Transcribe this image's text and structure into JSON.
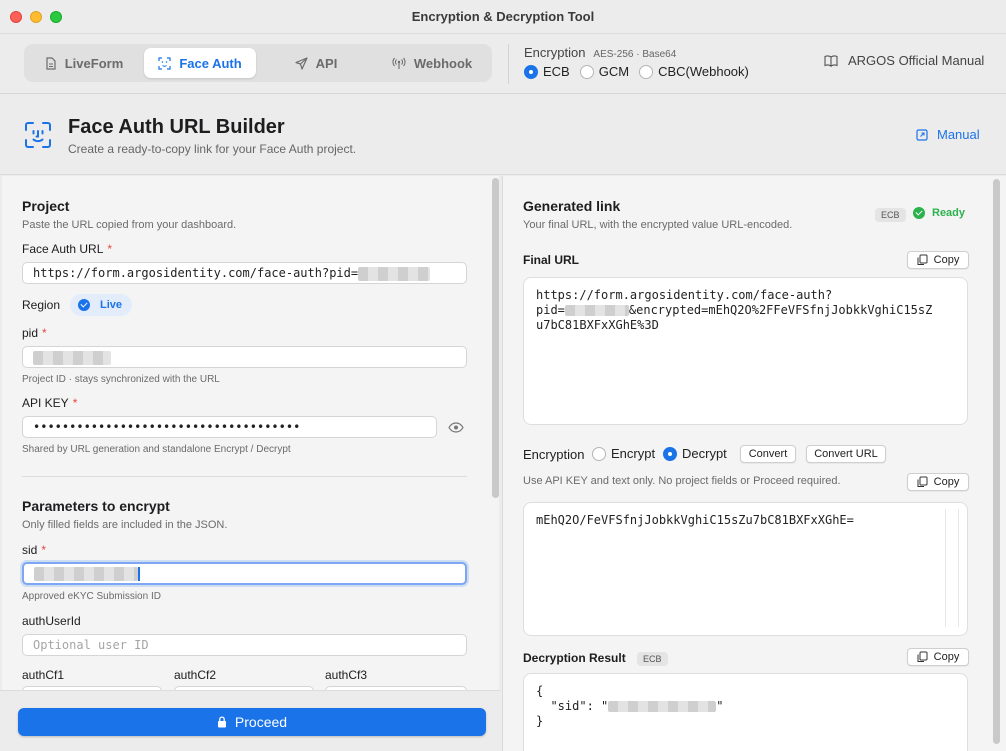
{
  "window": {
    "title": "Encryption & Decryption Tool"
  },
  "tabs": [
    {
      "label": "LiveForm",
      "icon": "document-icon"
    },
    {
      "label": "Face Auth",
      "icon": "face-id-icon",
      "active": true
    },
    {
      "label": "API",
      "icon": "paper-plane-icon"
    },
    {
      "label": "Webhook",
      "icon": "broadcast-icon"
    }
  ],
  "encryption_mode": {
    "label": "Encryption",
    "detail": "AES-256 · Base64",
    "options": [
      "ECB",
      "GCM",
      "CBC(Webhook)"
    ],
    "selected": "ECB"
  },
  "official_manual": {
    "label": "ARGOS Official Manual",
    "icon": "book-icon"
  },
  "header": {
    "title": "Face Auth URL Builder",
    "subtitle": "Create a ready-to-copy link for your Face Auth project.",
    "manual_label": "Manual"
  },
  "project": {
    "title": "Project",
    "hint": "Paste the URL copied from your dashboard.",
    "face_auth_url_label": "Face Auth URL",
    "face_auth_url_value": "https://form.argosidentity.com/face-auth?pid=",
    "region_label": "Region",
    "region_value": "Live",
    "pid_label": "pid",
    "pid_hint": "Project ID · stays synchronized with the URL",
    "api_key_label": "API KEY",
    "api_key_value": "•••••••••••••••••••••••••••••••••••••",
    "api_key_hint": "Shared by URL generation and standalone Encrypt / Decrypt"
  },
  "params": {
    "title": "Parameters to encrypt",
    "hint": "Only filled fields are included in the JSON.",
    "sid_label": "sid",
    "sid_hint": "Approved eKYC Submission ID",
    "auth_user_id_label": "authUserId",
    "auth_user_id_placeholder": "Optional user ID",
    "cf_labels": [
      "authCf1",
      "authCf2",
      "authCf3"
    ]
  },
  "proceed_label": "Proceed",
  "generated": {
    "title": "Generated link",
    "hint": "Your final URL, with the encrypted value URL-encoded.",
    "mode_chip": "ECB",
    "status": "Ready",
    "final_url_label": "Final URL",
    "copy_label": "Copy",
    "final_url_line1": "https://form.argosidentity.com/face-auth?",
    "final_url_line2_prefix": "pid=",
    "final_url_line2_suffix": "&encrypted=mEhQ2O%2FFeVFSfnjJobkkVghiC15sZ",
    "final_url_line3": "u7bC81BXFxXGhE%3D"
  },
  "encryption_tool": {
    "label": "Encryption",
    "options": [
      "Encrypt",
      "Decrypt"
    ],
    "selected": "Decrypt",
    "convert_label": "Convert",
    "convert_url_label": "Convert URL",
    "hint": "Use API KEY and text only. No project fields or Proceed required.",
    "copy_label": "Copy",
    "text_value": "mEhQ2O/FeVFSfnjJobkkVghiC15sZu7bC81BXFxXGhE="
  },
  "decryption_result": {
    "label": "Decryption Result",
    "mode_chip": "ECB",
    "copy_label": "Copy",
    "line_open": "{",
    "sid_key": "\"sid\": \"",
    "sid_close": "\"",
    "line_close": "}"
  },
  "colors": {
    "accent": "#1a73e8",
    "ready": "#2bb24c",
    "required": "#e5483f"
  }
}
